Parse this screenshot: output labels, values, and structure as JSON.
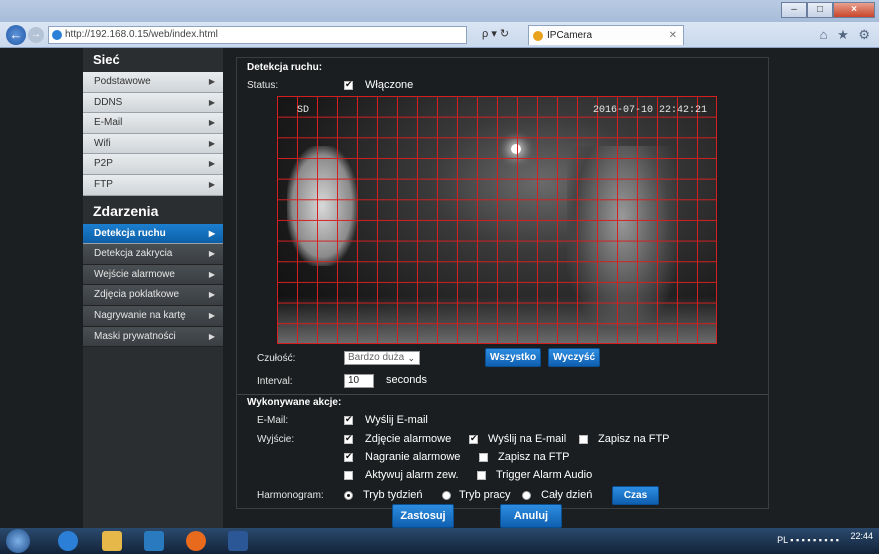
{
  "browser": {
    "url": "http://192.168.0.15/web/index.html",
    "tab_title": "IPCamera",
    "search_glyph": "ρ ▾ ↻",
    "tab_close": "✕",
    "right_icons": "⌂ ★ ⚙"
  },
  "sidebar": {
    "section1": "Sieć",
    "items1": [
      "Podstawowe",
      "DDNS",
      "E-Mail",
      "Wifi",
      "P2P",
      "FTP"
    ],
    "section2": "Zdarzenia",
    "items2": [
      "Detekcja ruchu",
      "Detekcja zakrycia",
      "Wejście alarmowe",
      "Zdjęcia poklatkowe",
      "Nagrywanie na kartę",
      "Maski prywatności"
    ],
    "active": "Detekcja ruchu"
  },
  "motion": {
    "title": "Detekcja ruchu:",
    "status_label": "Status:",
    "status_value": "Włączone",
    "osd_channel": "SD",
    "osd_datetime": "2016-07-10 22:42:21",
    "sensitivity_label": "Czułość:",
    "sensitivity_value": "Bardzo duża",
    "all_button": "Wszystko",
    "clear_button": "Wyczyść",
    "interval_label": "Interval:",
    "interval_value": "10",
    "interval_unit": "seconds"
  },
  "actions": {
    "title": "Wykonywane akcje:",
    "email_label": "E-Mail:",
    "email_send": "Wyślij E-mail",
    "output_label": "Wyjście:",
    "snapshot": "Zdjęcie alarmowe",
    "send_email": "Wyślij na E-mail",
    "save_ftp_1": "Zapisz na FTP",
    "recording": "Nagranie alarmowe",
    "save_ftp_2": "Zapisz na FTP",
    "activate_alarm": "Aktywuj alarm zew.",
    "trigger_audio": "Trigger Alarm Audio",
    "schedule_label": "Harmonogram:",
    "week_mode": "Tryb tydzień",
    "work_mode": "Tryb pracy",
    "all_day": "Cały dzień",
    "time_button": "Czas"
  },
  "footer": {
    "apply": "Zastosuj",
    "cancel": "Anuluj"
  },
  "taskbar": {
    "lang": "PL",
    "time": "22:44"
  },
  "colors": {
    "accent": "#0f6cc0",
    "grid": "#d42020",
    "sidebar_bg": "#2a2e31"
  }
}
